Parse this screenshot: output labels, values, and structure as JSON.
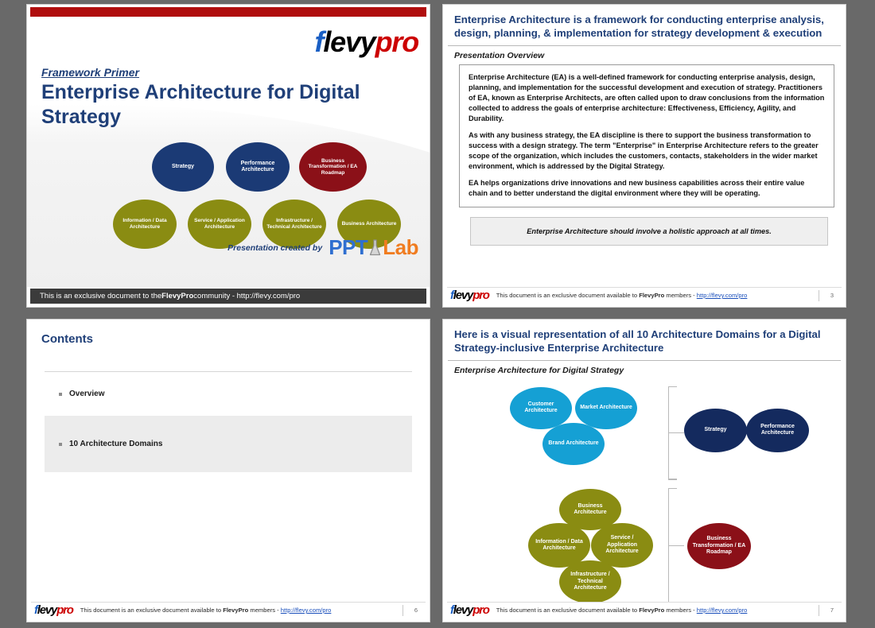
{
  "theme": {
    "navy": "#1f3f78",
    "ellipse_navy": "#1b3a75",
    "ellipse_navy_dark": "#142a5e",
    "ellipse_dark_red": "#8b1018",
    "ellipse_olive": "#8a8c12",
    "ellipse_blue": "#15a0d4",
    "red_bar": "#b00d0d",
    "page_background": "#696969",
    "footer_dark": "#3b3b3b"
  },
  "brand": {
    "logo_f": "f",
    "logo_levy": "levy",
    "logo_pro": "pro",
    "pptlab_ppt": "PPT",
    "pptlab_lab": "Lab",
    "flask_icon": "flask-icon"
  },
  "slide1": {
    "eyebrow": "Framework Primer",
    "title": "Enterprise Architecture for Digital Strategy",
    "credit_label": "Presentation created by",
    "footer_pre": "This is an exclusive document to the ",
    "footer_brand": "FlevyPro",
    "footer_post": " community - http://flevy.com/pro",
    "ellipses": [
      {
        "label": "Strategy",
        "color": "navy"
      },
      {
        "label": "Performance Architecture",
        "color": "navy"
      },
      {
        "label": "Business Transformation / EA Roadmap",
        "color": "dkred"
      },
      {
        "label": "Information / Data Architecture",
        "color": "olive"
      },
      {
        "label": "Service / Application Architecture",
        "color": "olive"
      },
      {
        "label": "Infrastructure / Technical Architecture",
        "color": "olive"
      },
      {
        "label": "Business Architecture",
        "color": "olive"
      }
    ]
  },
  "slide2": {
    "heading": "Enterprise Architecture is a framework for conducting enterprise analysis, design, planning, & implementation for strategy development & execution",
    "subheading": "Presentation Overview",
    "paragraphs": [
      "Enterprise Architecture (EA) is a well-defined framework for conducting enterprise analysis, design, planning, and implementation for the successful development and execution of strategy.  Practitioners of EA, known as Enterprise Architects, are often called upon to draw conclusions from the information collected to address the goals of enterprise architecture: Effectiveness, Efficiency, Agility, and Durability.",
      "As with any business strategy, the EA discipline is there to support the business transformation to success with a design strategy. The term \"Enterprise\" in Enterprise Architecture refers to the greater scope of the organization, which includes the customers, contacts, stakeholders in the wider market environment, which is addressed by the Digital Strategy.",
      "EA helps organizations drive innovations and new business capabilities across their entire value chain and to better understand the digital environment where they will be operating."
    ],
    "callout": "Enterprise Architecture should involve a holistic approach at all times.",
    "footer_pre": "This document is an exclusive document available to ",
    "footer_brand": "FlevyPro",
    "footer_mid": " members - ",
    "footer_link": "http://flevy.com/pro",
    "page_number": "3"
  },
  "slide3": {
    "title": "Contents",
    "items": [
      {
        "label": "Overview",
        "highlighted": false
      },
      {
        "label": "10 Architecture Domains",
        "highlighted": true
      }
    ],
    "footer_pre": "This document is an exclusive document available to ",
    "footer_brand": "FlevyPro",
    "footer_mid": " members - ",
    "footer_link": "http://flevy.com/pro",
    "page_number": "6"
  },
  "slide4": {
    "heading": "Here is a visual representation of all 10 Architecture Domains for a Digital Strategy-inclusive Enterprise Architecture",
    "subheading": "Enterprise Architecture for Digital Strategy",
    "nodes": [
      {
        "label": "Customer Architecture",
        "color": "blue"
      },
      {
        "label": "Market Architecture",
        "color": "blue"
      },
      {
        "label": "Brand Architecture",
        "color": "blue"
      },
      {
        "label": "Strategy",
        "color": "navy2"
      },
      {
        "label": "Performance Architecture",
        "color": "navy2"
      },
      {
        "label": "Business Architecture",
        "color": "olive"
      },
      {
        "label": "Information / Data Architecture",
        "color": "olive"
      },
      {
        "label": "Service / Application Architecture",
        "color": "olive"
      },
      {
        "label": "Infrastructure / Technical Architecture",
        "color": "olive"
      },
      {
        "label": "Business Transformation / EA Roadmap",
        "color": "dkred"
      }
    ],
    "footer_pre": "This document is an exclusive document available to ",
    "footer_brand": "FlevyPro",
    "footer_mid": " members - ",
    "footer_link": "http://flevy.com/pro",
    "page_number": "7"
  }
}
